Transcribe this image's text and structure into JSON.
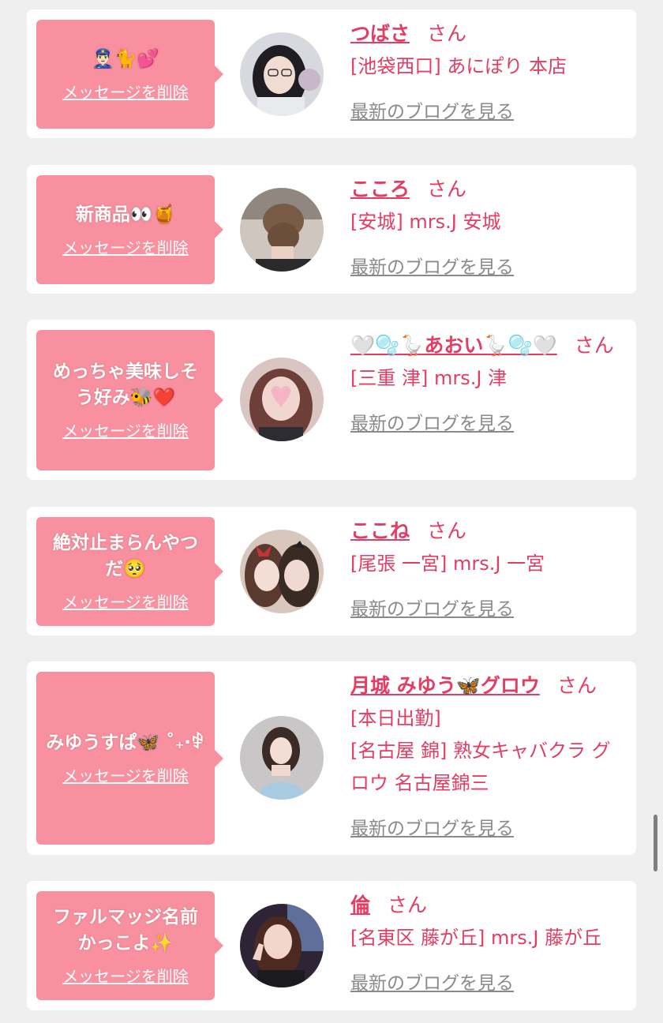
{
  "delete_label": "メッセージを削除",
  "blog_label": "最新のブログを見る",
  "san_label": "さん",
  "colors": {
    "bubble": "#f8909f",
    "accent": "#e33d63",
    "link_gray": "#8a8a8a",
    "background": "#efefef"
  },
  "cards": [
    {
      "message": "👮🏻‍♂️🐈💕",
      "name": "つばさ",
      "shop_lines": [
        "[池袋西口] あにぽり 本店"
      ]
    },
    {
      "message": "新商品👀🍯",
      "name": "こころ",
      "shop_lines": [
        "[安城] mrs.J 安城"
      ]
    },
    {
      "message": "めっちゃ美味しそう好み🐝❤️",
      "name": "🤍🫧🪿あおい🪿🫧🤍",
      "shop_lines": [
        "[三重 津] mrs.J 津"
      ]
    },
    {
      "message": "絶対止まらんやつだ🥺",
      "name": "ここね",
      "shop_lines": [
        "[尾張 一宮] mrs.J 一宮"
      ]
    },
    {
      "message": "みゆうすぱ🦋 ˚₊‧ꒆ",
      "name": "月城 みゆう🦋グロウ",
      "shop_lines": [
        "[本日出勤]",
        "[名古屋 錦] 熟女キャバクラ グロウ 名古屋錦三"
      ]
    },
    {
      "message": "ファルマッジ名前かっこよ✨",
      "name": "倫",
      "shop_lines": [
        "[名東区 藤が丘] mrs.J 藤が丘"
      ]
    }
  ]
}
